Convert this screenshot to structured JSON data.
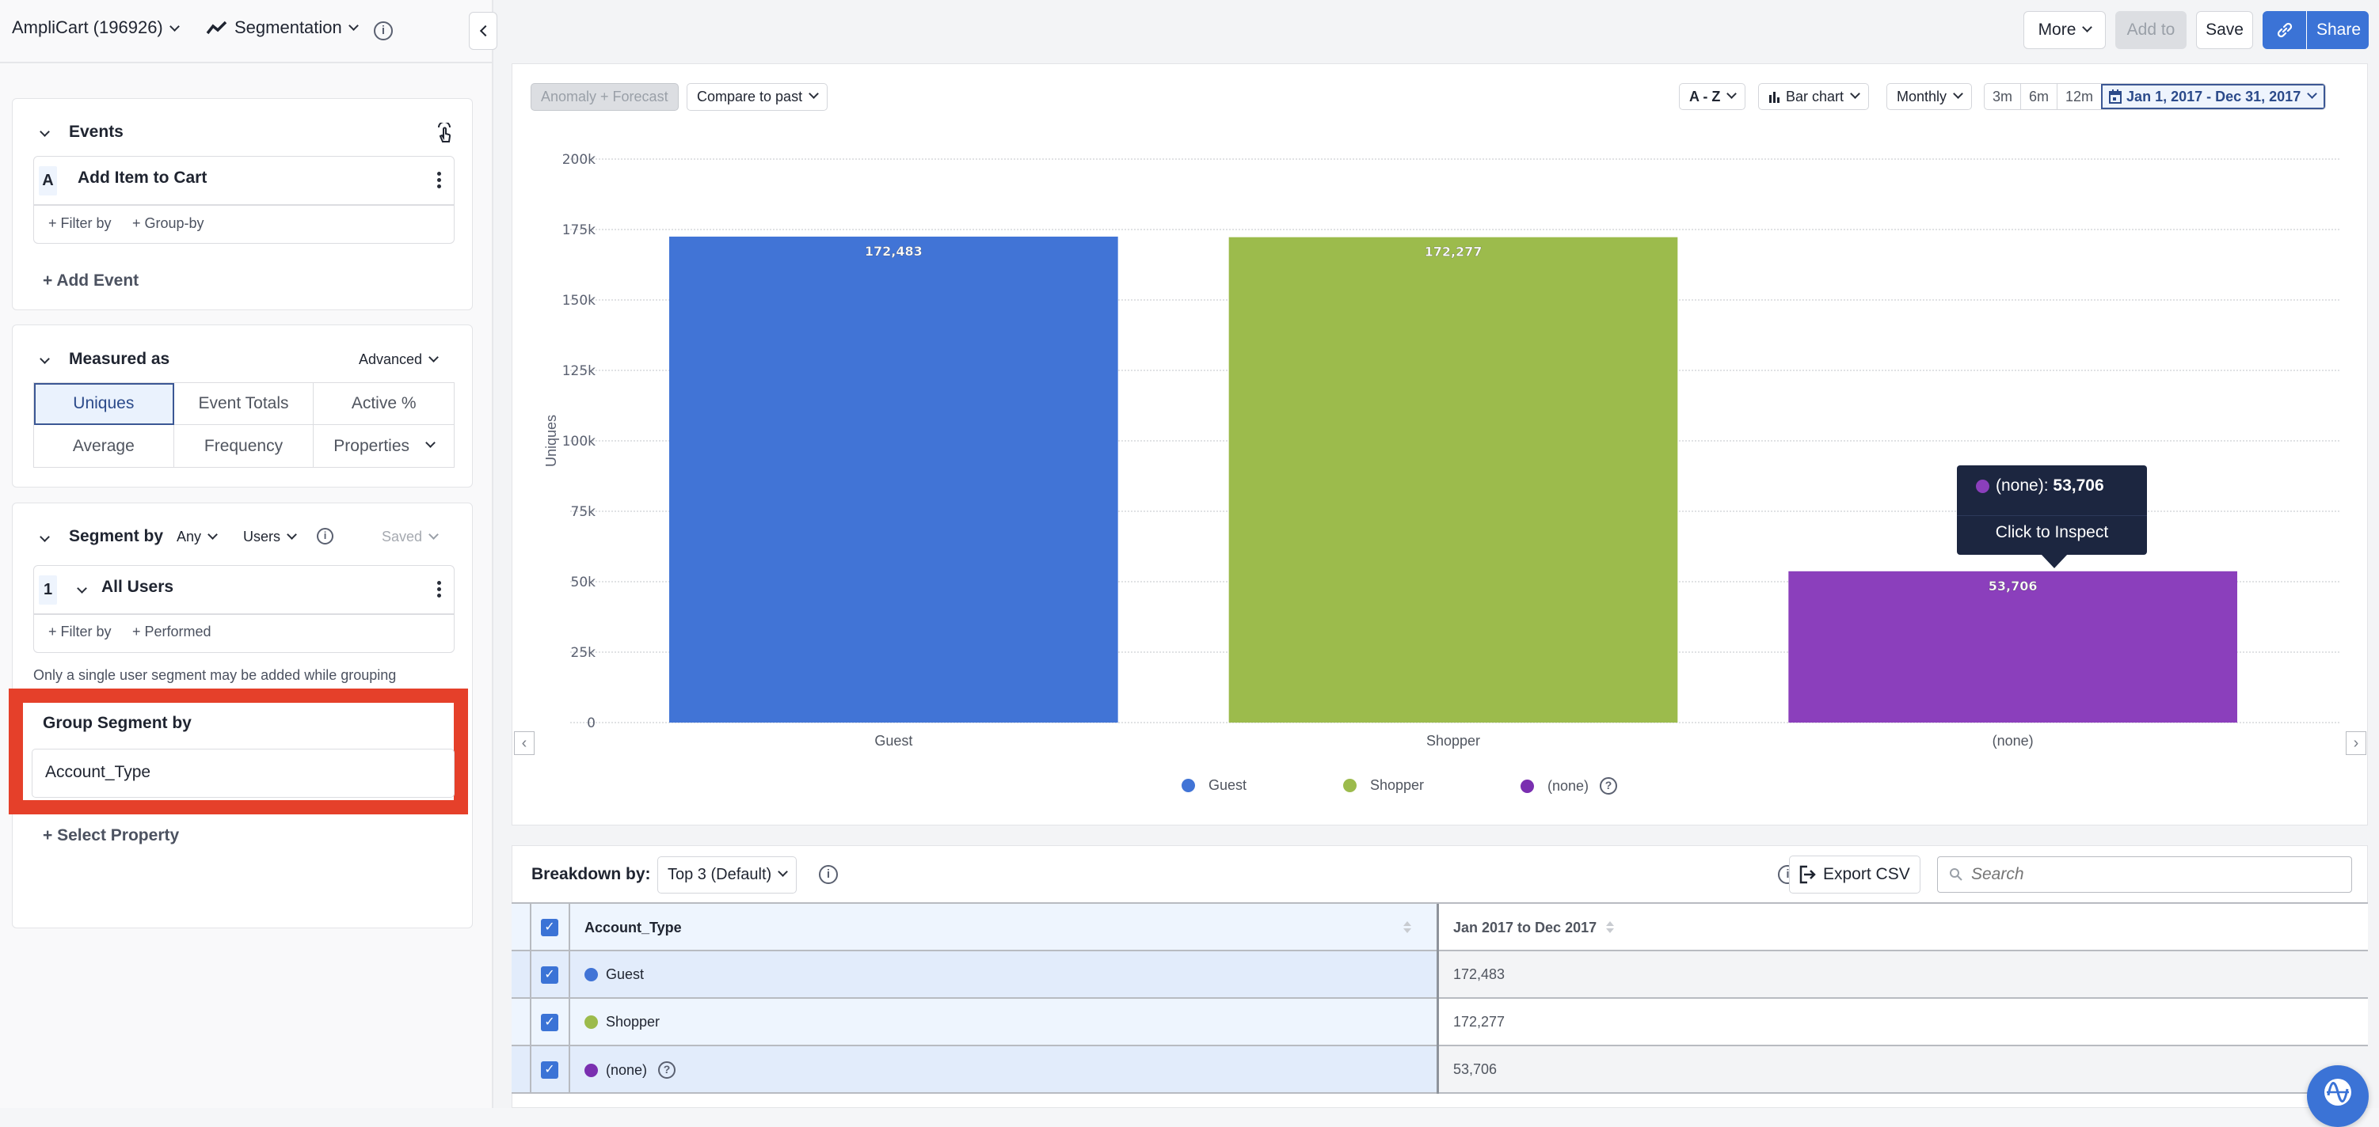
{
  "header": {
    "project": "AmpliCart (196926)",
    "chart_type": "Segmentation",
    "buttons": {
      "more": "More",
      "add_to": "Add to",
      "save": "Save",
      "share": "Share"
    }
  },
  "sidebar": {
    "events": {
      "title": "Events",
      "items": [
        {
          "letter": "A",
          "name": "Add Item to Cart",
          "filter_by": "+ Filter by",
          "group_by": "+ Group-by"
        }
      ],
      "add_event": "+ Add Event"
    },
    "measured_as": {
      "title": "Measured as",
      "advanced": "Advanced",
      "options": [
        "Uniques",
        "Event Totals",
        "Active %",
        "Average",
        "Frequency",
        "Properties"
      ],
      "selected": "Uniques"
    },
    "segment_by": {
      "title": "Segment by",
      "any": "Any",
      "users": "Users",
      "saved": "Saved",
      "segments": [
        {
          "index": "1",
          "name": "All Users",
          "filter_by": "+ Filter by",
          "performed": "+ Performed"
        }
      ],
      "note": "Only a single user segment may be added while grouping"
    },
    "group_segment": {
      "title": "Group Segment by",
      "property": "Account_Type",
      "select_property": "+ Select Property"
    }
  },
  "toolbar": {
    "anomaly": "Anomaly + Forecast",
    "compare": "Compare to past",
    "sort": "A - Z",
    "chart_kind": "Bar chart",
    "interval": "Monthly",
    "ranges": [
      "3m",
      "6m",
      "12m"
    ],
    "date_range": "Jan 1, 2017 - Dec 31, 2017"
  },
  "tooltip": {
    "label": "(none):",
    "value": "53,706",
    "action": "Click to Inspect",
    "color": "#8b3fbc"
  },
  "chart_data": {
    "type": "bar",
    "categories": [
      "Guest",
      "Shopper",
      "(none)"
    ],
    "values": [
      172483,
      172277,
      53706
    ],
    "value_labels": [
      "172,483",
      "172,277",
      "53,706"
    ],
    "colors": [
      "#4174d6",
      "#9cbb4c",
      "#8b3fbc"
    ],
    "title": "",
    "xlabel": "",
    "ylabel": "Uniques",
    "ylim": [
      0,
      200000
    ],
    "yticks": [
      0,
      25000,
      50000,
      75000,
      100000,
      125000,
      150000,
      175000,
      200000
    ],
    "ytick_labels": [
      "0",
      "25k",
      "50k",
      "75k",
      "100k",
      "125k",
      "150k",
      "175k",
      "200k"
    ],
    "grid": true,
    "legend": [
      {
        "name": "Guest",
        "color": "#4174d6"
      },
      {
        "name": "Shopper",
        "color": "#9cbb4c"
      },
      {
        "name": "(none)",
        "color": "#7a2fb0"
      }
    ],
    "legend_position": "bottom"
  },
  "breakdown": {
    "label": "Breakdown by:",
    "selected": "Top 3 (Default)",
    "export": "Export CSV",
    "search_placeholder": "Search",
    "columns": [
      "Account_Type",
      "Jan 2017 to Dec 2017"
    ],
    "rows": [
      {
        "name": "Guest",
        "value": "172,483",
        "color": "#4174d6",
        "checked": true
      },
      {
        "name": "Shopper",
        "value": "172,277",
        "color": "#9cbb4c",
        "checked": true
      },
      {
        "name": "(none)",
        "value": "53,706",
        "color": "#7a2fb0",
        "checked": true
      }
    ]
  }
}
